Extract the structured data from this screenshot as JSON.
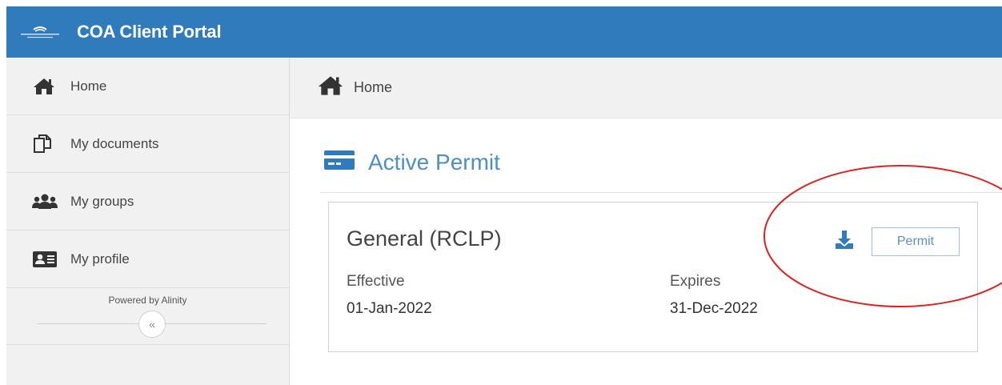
{
  "header": {
    "app_title": "COA Client Portal",
    "logo_icon": "college-logo-icon",
    "brand_color": "#2f7bbc"
  },
  "sidebar": {
    "items": [
      {
        "label": "Home",
        "icon": "home-icon"
      },
      {
        "label": "My documents",
        "icon": "documents-icon"
      },
      {
        "label": "My groups",
        "icon": "groups-icon"
      },
      {
        "label": "My profile",
        "icon": "profile-card-icon"
      }
    ],
    "powered_by": "Powered by Alinity",
    "collapse_label": "«"
  },
  "breadcrumb": {
    "label": "Home",
    "icon": "home-icon"
  },
  "main": {
    "section_title": "Active Permit",
    "section_icon": "credit-card-icon",
    "accent_color": "#4d8fc8",
    "permit": {
      "title": "General (RCLP)",
      "effective_label": "Effective",
      "effective_value": "01-Jan-2022",
      "expires_label": "Expires",
      "expires_value": "31-Dec-2022",
      "download_icon": "download-icon",
      "permit_button_label": "Permit"
    }
  },
  "annotation": {
    "shape": "red-ellipse-circle",
    "color": "#e0201f"
  }
}
